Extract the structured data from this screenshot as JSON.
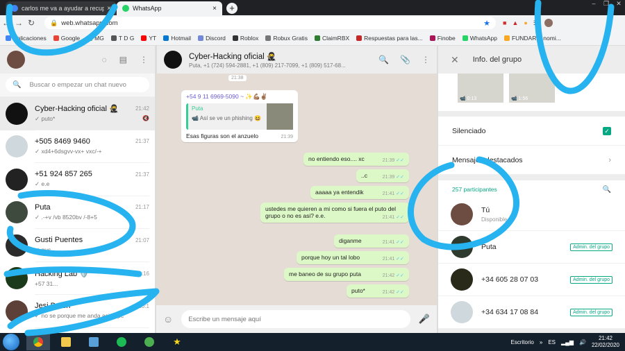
{
  "browser": {
    "tabs": [
      {
        "label": "carlos me va a ayudar a recuperar",
        "close": "×"
      },
      {
        "label": "WhatsApp",
        "close": "×"
      }
    ],
    "new_tab": "+",
    "window_controls": [
      "–",
      "❐",
      "✕"
    ],
    "url": "web.whatsapp.com",
    "bookmarks": [
      {
        "label": "Aplicaciones",
        "color": "#4285f4"
      },
      {
        "label": "Google",
        "color": "#ea4335"
      },
      {
        "label": "MG",
        "color": "#34a853"
      },
      {
        "label": "T D G",
        "color": "#555555"
      },
      {
        "label": "YT",
        "color": "#ff0000"
      },
      {
        "label": "Hotmail",
        "color": "#0078d4"
      },
      {
        "label": "Discord",
        "color": "#7289da"
      },
      {
        "label": "Roblox",
        "color": "#333333"
      },
      {
        "label": "Robux Gratis",
        "color": "#777777"
      },
      {
        "label": "ClaimRBX",
        "color": "#2e7d32"
      },
      {
        "label": "Respuestas para las...",
        "color": "#c62828"
      },
      {
        "label": "Finobe",
        "color": "#ad1457"
      },
      {
        "label": "WhatsApp",
        "color": "#25d366"
      },
      {
        "label": "FUNDARIA nomi...",
        "color": "#f9a825"
      }
    ]
  },
  "left": {
    "search_placeholder": "Buscar o empezar un chat nuevo",
    "chats": [
      {
        "name": "Cyber-Hacking oficial 🥷",
        "time": "21:42",
        "preview": "✓ puto*",
        "muted": "🔇",
        "color": "#111111"
      },
      {
        "name": "+505 8469 9460",
        "time": "21:37",
        "preview": "✓ xd4+6dsgvv-vx+ vxc/-+",
        "muted": "",
        "color": "#cfd8dc"
      },
      {
        "name": "+51 924 857 265",
        "time": "21:37",
        "preview": "✓ e.e",
        "muted": "",
        "color": "#222222"
      },
      {
        "name": "Puta",
        "time": "21:17",
        "preview": "✓ .-+v /vb 8520bv /-8+5",
        "muted": "",
        "color": "#3e4a3e"
      },
      {
        "name": "Gusti Puentes",
        "time": "21:07",
        "preview": "✓ gus",
        "muted": "",
        "color": "#2b2b2b"
      },
      {
        "name": "Hacking Lab 🛡️",
        "time": "20:16",
        "preview": "+57 31...",
        "muted": "",
        "color": "#1b3a1b"
      },
      {
        "name": "Jesi Brach",
        "time": "20:1",
        "preview": "✓ no se porque me anda asi la pc",
        "muted": "",
        "color": "#5d4037"
      }
    ]
  },
  "chat": {
    "title": "Cyber-Hacking oficial 🥷",
    "members": "Puta, +1 (724) 594-2881, +1 (809) 217-7099, +1 (809) 517-68...",
    "top_time": "21:38",
    "incoming": {
      "sender": "+54 9 11 6969-5090 ~ ✨💪🏽✌🏽",
      "quote_name": "Puta",
      "quote_text": "📹 Así se ve un phishing 😆",
      "text": "Esas figuras  son el anzuelo",
      "time": "21:39"
    },
    "outgoing": [
      {
        "text": "no entiendo eso.... xc",
        "time": "21:39"
      },
      {
        "text": "..c",
        "time": "21:39"
      },
      {
        "text": "aaaaa ya entendik",
        "time": "21:41"
      },
      {
        "text": "ustedes me quieren a mi como si fuera el puto del grupo o no es asi? e.e.",
        "time": "21:41"
      },
      {
        "text": "diganme",
        "time": "21:41"
      },
      {
        "text": "porque hoy un tal lobo",
        "time": "21:41"
      },
      {
        "text": "me baneo de su grupo puta",
        "time": "21:42"
      },
      {
        "text": "puto*",
        "time": "21:42"
      }
    ],
    "composer_placeholder": "Escribe un mensaje aquí"
  },
  "info": {
    "title": "Info. del grupo",
    "media": [
      {
        "duration": "📹 0:13"
      },
      {
        "duration": "📹 1:56"
      }
    ],
    "muted_label": "Silenciado",
    "starred_label": "Mensajes destacados",
    "participants_label": "257 participantes",
    "members": [
      {
        "name": "Tú",
        "status": "Disponible",
        "badge": "",
        "color": "#6d4c41"
      },
      {
        "name": "Puta",
        "status": "",
        "badge": "Admin. del grupo",
        "color": "#2d3a2d"
      },
      {
        "name": "+34 605 28 07 03",
        "status": "",
        "badge": "Admin. del grupo",
        "color": "#2a2a1a"
      },
      {
        "name": "+34 634 17 08 84",
        "status": "",
        "badge": "Admin. del grupo",
        "color": "#cfd8dc"
      }
    ]
  },
  "taskbar": {
    "desktop_label": "Escritorio",
    "lang": "ES",
    "time": "21:42",
    "date": "22/02/2020"
  },
  "colors": {
    "accent": "#06a884",
    "outgoing_bubble": "#dcf8c6",
    "scribble": "#27b3f0"
  }
}
